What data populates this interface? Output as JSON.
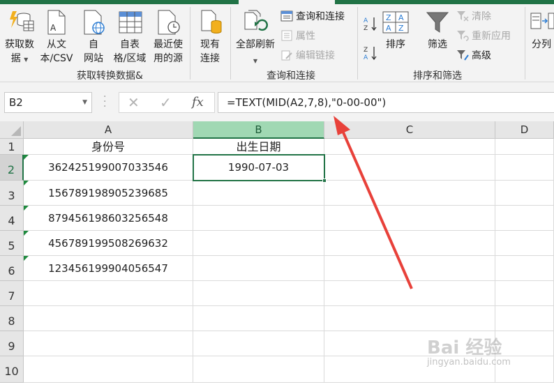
{
  "ribbon": {
    "get_data": {
      "label1": "获取数",
      "label2": "据"
    },
    "from_text": {
      "label1": "从文",
      "label2": "本/CSV"
    },
    "from_web": {
      "label1": "自",
      "label2": "网站"
    },
    "from_table": {
      "label1": "自表",
      "label2": "格/区域"
    },
    "recent_sources": {
      "label1": "最近使",
      "label2": "用的源"
    },
    "existing_conn": {
      "label1": "现有",
      "label2": "连接"
    },
    "refresh_all": {
      "label1": "全部刷新"
    },
    "queries_connections": "查询和连接",
    "properties": "属性",
    "edit_links": "编辑链接",
    "sort": "排序",
    "filter": "筛选",
    "clear": "清除",
    "reapply": "重新应用",
    "advanced": "高级",
    "split": "分列",
    "groups": {
      "get_transform": "获取转换数据&",
      "queries": "查询和连接",
      "sort_filter": "排序和筛选"
    }
  },
  "formula_bar": {
    "name_box": "B2",
    "cancel": "✕",
    "enter": "✓",
    "fx": "fx",
    "formula": "=TEXT(MID(A2,7,8),\"0-00-00\")"
  },
  "sheet": {
    "columns": [
      "A",
      "B",
      "C",
      "D"
    ],
    "rows": [
      "1",
      "2",
      "3",
      "4",
      "5",
      "6",
      "7",
      "8",
      "9",
      "10"
    ],
    "headers": {
      "a1": "身份号",
      "b1": "出生日期"
    },
    "ids": [
      "362425199007033546",
      "156789198905239685",
      "879456198603256548",
      "456789199508269632",
      "123456199904056547"
    ],
    "b2": "1990-07-03"
  },
  "watermark": {
    "line1": "Bai 经验",
    "line2": "jingyan.baidu.com"
  },
  "colors": {
    "excel_green": "#217346",
    "arrow": "#e8413a"
  }
}
